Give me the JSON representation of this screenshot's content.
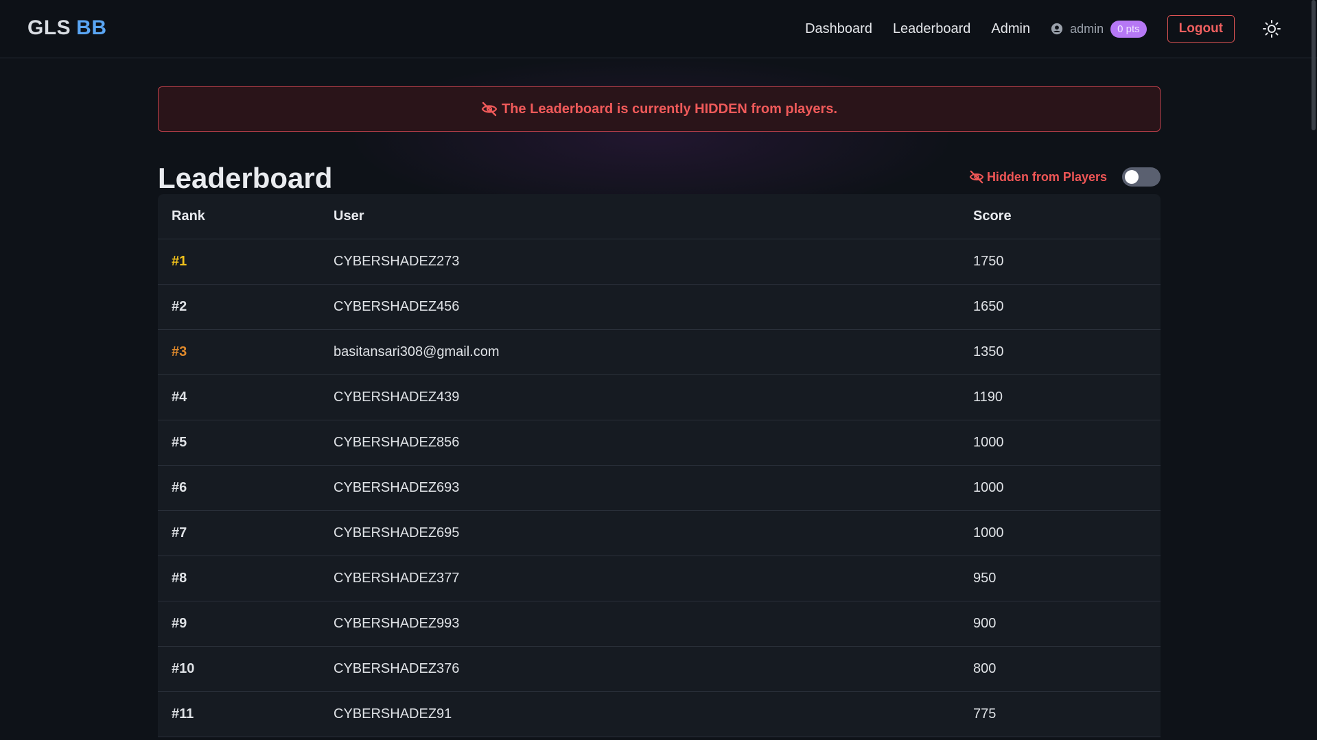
{
  "brand": {
    "part1": "GLS",
    "part2": "BB"
  },
  "nav": {
    "links": [
      "Dashboard",
      "Leaderboard",
      "Admin"
    ],
    "user": "admin",
    "points": "0 pts",
    "logout": "Logout"
  },
  "alert": {
    "text": "The Leaderboard is currently HIDDEN from players."
  },
  "page": {
    "title": "Leaderboard"
  },
  "visibility": {
    "label": "Hidden from Players",
    "enabled": false
  },
  "table": {
    "columns": [
      "Rank",
      "User",
      "Score"
    ],
    "rows": [
      {
        "rank": "#1",
        "user": "CYBERSHADEZ273",
        "score": "1750"
      },
      {
        "rank": "#2",
        "user": "CYBERSHADEZ456",
        "score": "1650"
      },
      {
        "rank": "#3",
        "user": "basitansari308@gmail.com",
        "score": "1350"
      },
      {
        "rank": "#4",
        "user": "CYBERSHADEZ439",
        "score": "1190"
      },
      {
        "rank": "#5",
        "user": "CYBERSHADEZ856",
        "score": "1000"
      },
      {
        "rank": "#6",
        "user": "CYBERSHADEZ693",
        "score": "1000"
      },
      {
        "rank": "#7",
        "user": "CYBERSHADEZ695",
        "score": "1000"
      },
      {
        "rank": "#8",
        "user": "CYBERSHADEZ377",
        "score": "950"
      },
      {
        "rank": "#9",
        "user": "CYBERSHADEZ993",
        "score": "900"
      },
      {
        "rank": "#10",
        "user": "CYBERSHADEZ376",
        "score": "800"
      },
      {
        "rank": "#11",
        "user": "CYBERSHADEZ91",
        "score": "775"
      }
    ]
  },
  "colors": {
    "accent_blue": "#5aa6f4",
    "danger": "#f05a5a",
    "gold": "#f1c21b",
    "bronze": "#e08a2c",
    "points_badge": "#b678f5"
  },
  "icons": {
    "alert": "eye-slash-icon",
    "user": "user-circle-icon",
    "theme": "sun-icon"
  }
}
